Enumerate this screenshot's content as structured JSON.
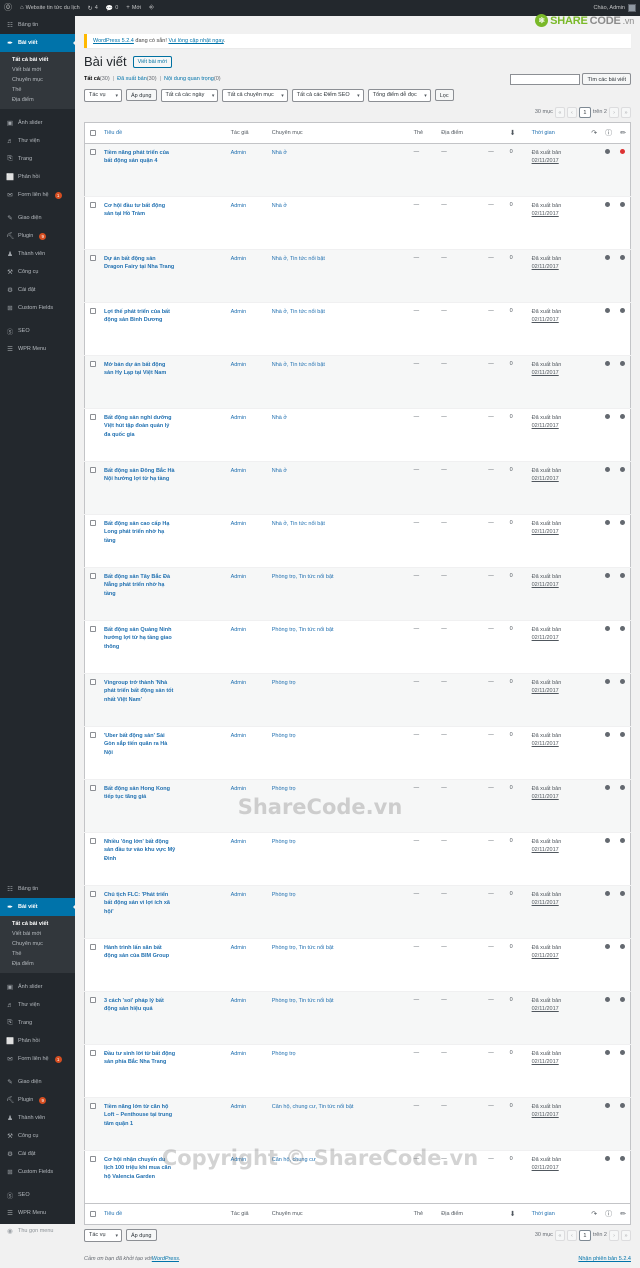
{
  "adminbar": {
    "wp_logo_icon": "wordpress-icon",
    "site_icon": "home-icon",
    "site_name": "Website tin tức du lịch",
    "updates_icon": "updates-icon",
    "updates_count": "4",
    "comments_icon": "comment-icon",
    "comments_count": "0",
    "new_icon": "plus-icon",
    "new_label": "Mới",
    "seo_icon": "seo-icon",
    "greeting": "Chào, Admin",
    "avatar_icon": "avatar-icon"
  },
  "logo": {
    "mark_icon": "sharecode-logo-icon",
    "share": "SHARE",
    "code": "CODE",
    "vn": ".vn"
  },
  "notice": {
    "link_version": "WordPress 5.2.4",
    "text_middle": " đang có sẵn! ",
    "link_update": "Vui lòng cập nhật ngay",
    "text_end": "."
  },
  "page": {
    "title": "Bài viết",
    "add_new": "Viết bài mới"
  },
  "views": {
    "all_label": "Tất cả",
    "all_count": "(30)",
    "published_label": "Đã xuất bản",
    "published_count": "(30)",
    "sticky_label": "Nội dung quan trọng",
    "sticky_count": "(0)",
    "separator": "|"
  },
  "search": {
    "value": "",
    "placeholder": "",
    "button": "Tìm các bài viết"
  },
  "toolbar": {
    "bulk_action": "Tác vụ",
    "apply": "Áp dụng",
    "filter_dates": "Tất cả các ngày",
    "filter_categories": "Tất cả chuyên mục",
    "filter_seo": "Tất cả các Điểm SEO",
    "filter_readability": "Tổng điểm dễ đọc",
    "filter_button": "Lọc"
  },
  "pagination": {
    "items": "30 mục",
    "first": "«",
    "prev": "‹",
    "current": "1",
    "of_label": "trên 2",
    "next": "›",
    "last": "»"
  },
  "table": {
    "columns": {
      "title": "Tiêu đề",
      "author": "Tác giả",
      "categories": "Chuyên mục",
      "tags": "Thẻ",
      "location": "Địa điểm",
      "comments_icon": "comment-icon",
      "date": "Thời gian",
      "duplicate_icon": "duplicate-icon",
      "seo_icon": "seo-score-icon",
      "readability_icon": "readability-pencil-icon"
    },
    "status_published": "Đã xuất bản",
    "dash": "—",
    "rows": [
      {
        "title": "Tiềm năng phát triển của bất động sản quận 4",
        "author": "Admin",
        "categories": "Nhà ở",
        "tags": "—",
        "location": "—",
        "extra": "—",
        "status": "Đã xuất bản",
        "date": "02/11/2017",
        "comments": "0",
        "seo_dot": "gray",
        "read_dot": "red"
      },
      {
        "title": "Cơ hội đầu tư bất động sản tại Hồ Tràm",
        "author": "Admin",
        "categories": "Nhà ở",
        "tags": "—",
        "location": "—",
        "extra": "—",
        "status": "Đã xuất bản",
        "date": "02/11/2017",
        "comments": "0",
        "seo_dot": "gray",
        "read_dot": "gray"
      },
      {
        "title": "Dự án bất động sản Dragon Fairy tại Nha Trang",
        "author": "Admin",
        "categories": "Nhà ở, Tin tức nổi bật",
        "tags": "—",
        "location": "—",
        "extra": "—",
        "status": "Đã xuất bản",
        "date": "02/11/2017",
        "comments": "0",
        "seo_dot": "gray",
        "read_dot": "gray"
      },
      {
        "title": "Lợi thế phát triển của bất động sản Bình Dương",
        "author": "Admin",
        "categories": "Nhà ở, Tin tức nổi bật",
        "tags": "—",
        "location": "—",
        "extra": "—",
        "status": "Đã xuất bản",
        "date": "02/11/2017",
        "comments": "0",
        "seo_dot": "gray",
        "read_dot": "gray"
      },
      {
        "title": "Mở bán dự án bất động sản Hy Lạp tại Việt Nam",
        "author": "Admin",
        "categories": "Nhà ở, Tin tức nổi bật",
        "tags": "—",
        "location": "—",
        "extra": "—",
        "status": "Đã xuất bản",
        "date": "02/11/2017",
        "comments": "0",
        "seo_dot": "gray",
        "read_dot": "gray"
      },
      {
        "title": "Bất động sản nghỉ dưỡng Việt hút tập đoàn quản lý đa quốc gia",
        "author": "Admin",
        "categories": "Nhà ở",
        "tags": "—",
        "location": "—",
        "extra": "—",
        "status": "Đã xuất bản",
        "date": "02/11/2017",
        "comments": "0",
        "seo_dot": "gray",
        "read_dot": "gray"
      },
      {
        "title": "Bất động sản Đông Bắc Hà Nội hưởng lợi từ hạ tầng",
        "author": "Admin",
        "categories": "Nhà ở",
        "tags": "—",
        "location": "—",
        "extra": "—",
        "status": "Đã xuất bản",
        "date": "02/11/2017",
        "comments": "0",
        "seo_dot": "gray",
        "read_dot": "gray"
      },
      {
        "title": "Bất động sản cao cấp Hạ Long phát triển nhờ hạ tầng",
        "author": "Admin",
        "categories": "Nhà ở, Tin tức nổi bật",
        "tags": "—",
        "location": "—",
        "extra": "—",
        "status": "Đã xuất bản",
        "date": "02/11/2017",
        "comments": "0",
        "seo_dot": "gray",
        "read_dot": "gray"
      },
      {
        "title": "Bất động sản Tây Bắc Đà Nẵng phát triển nhờ hạ tầng",
        "author": "Admin",
        "categories": "Phòng trọ, Tin tức nổi bật",
        "tags": "—",
        "location": "—",
        "extra": "—",
        "status": "Đã xuất bản",
        "date": "02/11/2017",
        "comments": "0",
        "seo_dot": "gray",
        "read_dot": "gray"
      },
      {
        "title": "Bất động sản Quảng Ninh hưởng lợi từ hạ tầng giao thông",
        "author": "Admin",
        "categories": "Phòng trọ, Tin tức nổi bật",
        "tags": "—",
        "location": "—",
        "extra": "—",
        "status": "Đã xuất bản",
        "date": "02/11/2017",
        "comments": "0",
        "seo_dot": "gray",
        "read_dot": "gray"
      },
      {
        "title": "Vingroup trở thành 'Nhà phát triển bất động sản tốt nhất Việt Nam'",
        "author": "Admin",
        "categories": "Phòng trọ",
        "tags": "—",
        "location": "—",
        "extra": "—",
        "status": "Đã xuất bản",
        "date": "02/11/2017",
        "comments": "0",
        "seo_dot": "gray",
        "read_dot": "gray"
      },
      {
        "title": "'Uber bất động sản' Sài Gòn sắp tiến quân ra Hà Nội",
        "author": "Admin",
        "categories": "Phòng trọ",
        "tags": "—",
        "location": "—",
        "extra": "—",
        "status": "Đã xuất bản",
        "date": "02/11/2017",
        "comments": "0",
        "seo_dot": "gray",
        "read_dot": "gray"
      },
      {
        "title": "Bất động sản Hong Kong tiếp tục tăng giá",
        "author": "Admin",
        "categories": "Phòng trọ",
        "tags": "—",
        "location": "—",
        "extra": "—",
        "status": "Đã xuất bản",
        "date": "02/11/2017",
        "comments": "0",
        "seo_dot": "gray",
        "read_dot": "gray"
      },
      {
        "title": "Nhiều 'ông lớn' bất động sản đầu tư vào khu vực Mỹ Đình",
        "author": "Admin",
        "categories": "Phòng trọ",
        "tags": "—",
        "location": "—",
        "extra": "—",
        "status": "Đã xuất bản",
        "date": "02/11/2017",
        "comments": "0",
        "seo_dot": "gray",
        "read_dot": "gray"
      },
      {
        "title": "Chủ tịch FLC: 'Phát triển bất động sản vì lợi ích xã hội'",
        "author": "Admin",
        "categories": "Phòng trọ",
        "tags": "—",
        "location": "—",
        "extra": "—",
        "status": "Đã xuất bản",
        "date": "02/11/2017",
        "comments": "0",
        "seo_dot": "gray",
        "read_dot": "gray"
      },
      {
        "title": "Hành trình lấn sân bất động sản của BIM Group",
        "author": "Admin",
        "categories": "Phòng trọ, Tin tức nổi bật",
        "tags": "—",
        "location": "—",
        "extra": "—",
        "status": "Đã xuất bản",
        "date": "02/11/2017",
        "comments": "0",
        "seo_dot": "gray",
        "read_dot": "gray"
      },
      {
        "title": "3 cách 'soi' pháp lý bất động sản hiệu quả",
        "author": "Admin",
        "categories": "Phòng trọ, Tin tức nổi bật",
        "tags": "—",
        "location": "—",
        "extra": "—",
        "status": "Đã xuất bản",
        "date": "02/11/2017",
        "comments": "0",
        "seo_dot": "gray",
        "read_dot": "gray"
      },
      {
        "title": "Đầu tư sinh lời từ bất động sản phía Bắc Nha Trang",
        "author": "Admin",
        "categories": "Phòng trọ",
        "tags": "—",
        "location": "—",
        "extra": "—",
        "status": "Đã xuất bản",
        "date": "02/11/2017",
        "comments": "0",
        "seo_dot": "gray",
        "read_dot": "gray"
      },
      {
        "title": "Tiềm năng lớn từ căn hộ Loft – Penthouse tại trung tâm quận 1",
        "author": "Admin",
        "categories": "Căn hộ, chung cư, Tin tức nổi bật",
        "tags": "—",
        "location": "—",
        "extra": "—",
        "status": "Đã xuất bản",
        "date": "02/11/2017",
        "comments": "0",
        "seo_dot": "gray",
        "read_dot": "gray"
      },
      {
        "title": "Cơ hội nhận chuyến du lịch 100 triệu khi mua căn hộ Valencia Garden",
        "author": "Admin",
        "categories": "Căn hộ, chung cư",
        "tags": "—",
        "location": "—",
        "extra": "—",
        "status": "Đã xuất bản",
        "date": "02/11/2017",
        "comments": "0",
        "seo_dot": "gray",
        "read_dot": "gray"
      }
    ]
  },
  "sidebar": {
    "items": [
      {
        "label": "Bảng tin",
        "icon": "dashboard-icon",
        "glyph": "☷"
      },
      {
        "label": "Bài viết",
        "icon": "pin-icon",
        "glyph": "✒",
        "current": true
      },
      {
        "label": "Ảnh slider",
        "icon": "slider-image-icon",
        "glyph": "▣"
      },
      {
        "label": "Thư viện",
        "icon": "media-library-icon",
        "glyph": "♬"
      },
      {
        "label": "Trang",
        "icon": "page-icon",
        "glyph": "⎘"
      },
      {
        "label": "Phản hồi",
        "icon": "comment-icon",
        "glyph": "⬛"
      },
      {
        "label": "Form liên hệ",
        "icon": "email-icon",
        "glyph": "✉",
        "badge": "1"
      },
      {
        "label": "Giao diện",
        "icon": "appearance-brush-icon",
        "glyph": "✎"
      },
      {
        "label": "Plugin",
        "icon": "plugin-icon",
        "glyph": "⛏",
        "badge": "9"
      },
      {
        "label": "Thành viên",
        "icon": "users-icon",
        "glyph": "♟"
      },
      {
        "label": "Công cụ",
        "icon": "tools-wrench-icon",
        "glyph": "⚒"
      },
      {
        "label": "Cài đặt",
        "icon": "settings-gear-icon",
        "glyph": "⚙"
      },
      {
        "label": "Custom Fields",
        "icon": "custom-fields-icon",
        "glyph": "⊞"
      },
      {
        "label": "SEO",
        "icon": "seo-icon",
        "glyph": "Ⓢ"
      },
      {
        "label": "WPR Menu",
        "icon": "wpr-menu-icon",
        "glyph": "☰"
      }
    ],
    "submenu": [
      {
        "label": "Tất cả bài viết",
        "current": true
      },
      {
        "label": "Viết bài mới"
      },
      {
        "label": "Chuyên mục"
      },
      {
        "label": "Thẻ"
      },
      {
        "label": "Địa điểm"
      }
    ],
    "collapse": {
      "label": "Thu gọn menu",
      "icon": "collapse-arrow-icon",
      "glyph": "◉"
    }
  },
  "footer": {
    "thanks_prefix": "Cảm ơn bạn đã khởi tạo với ",
    "thanks_link": "WordPress",
    "thanks_suffix": ".",
    "version_link": "Nhận phiên bản 5.2.4"
  },
  "watermarks": {
    "top": "ShareCode.vn",
    "bottom": "Copyright © ShareCode.vn"
  }
}
